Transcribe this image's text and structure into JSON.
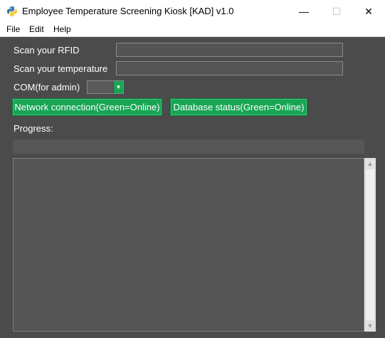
{
  "window": {
    "title": "Employee Temperature Screening Kiosk [KAD] v1.0",
    "minimize": "—",
    "maximize": "☐",
    "close": "✕"
  },
  "menu": [
    "File",
    "Edit",
    "Help"
  ],
  "form": {
    "rfid_label": "Scan your RFID",
    "rfid_value": "",
    "temp_label": "Scan your temperature",
    "temp_value": "",
    "com_label": "COM(for admin)",
    "com_value": ""
  },
  "buttons": {
    "network": "Network connection(Green=Online)",
    "database": "Database status(Green=Online)"
  },
  "progress": {
    "label": "Progress:",
    "value": 0
  },
  "log": {
    "text": ""
  },
  "colors": {
    "background": "#4b4b4b",
    "accent_green": "#18a554"
  },
  "icons": {
    "app": "python-icon",
    "combo": "chevron-down-icon",
    "scroll_up": "chevron-up-icon",
    "scroll_down": "chevron-down-icon"
  }
}
